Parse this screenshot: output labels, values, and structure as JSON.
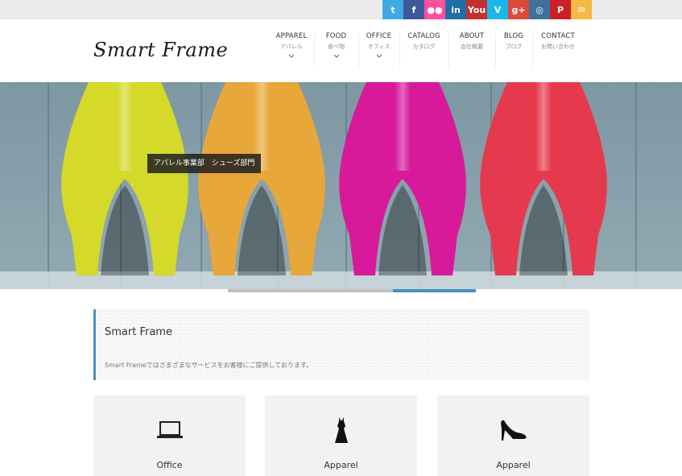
{
  "brand": {
    "logo": "Smart Frame"
  },
  "social": [
    {
      "name": "twitter-icon",
      "glyph": "t",
      "color": "#3fa9e6"
    },
    {
      "name": "facebook-icon",
      "glyph": "f",
      "color": "#3b5998"
    },
    {
      "name": "flickr-icon",
      "glyph": "●●",
      "color": "#ff4fa0"
    },
    {
      "name": "linkedin-icon",
      "glyph": "in",
      "color": "#1d6fa5"
    },
    {
      "name": "youtube-icon",
      "glyph": "You",
      "color": "#c4302b"
    },
    {
      "name": "vimeo-icon",
      "glyph": "V",
      "color": "#1ab7ea"
    },
    {
      "name": "google-plus-icon",
      "glyph": "g+",
      "color": "#dc4a38"
    },
    {
      "name": "instagram-icon",
      "glyph": "◎",
      "color": "#3f729b"
    },
    {
      "name": "pinterest-icon",
      "glyph": "P",
      "color": "#cb2027"
    },
    {
      "name": "mail-icon",
      "glyph": "✉",
      "color": "#f4b942"
    }
  ],
  "nav": [
    {
      "en": "APPAREL",
      "jp": "アパレル",
      "dropdown": true
    },
    {
      "en": "FOOD",
      "jp": "食べ物",
      "dropdown": true
    },
    {
      "en": "OFFICE",
      "jp": "オフィス",
      "dropdown": true
    },
    {
      "en": "CATALOG",
      "jp": "カタログ",
      "dropdown": false
    },
    {
      "en": "ABOUT",
      "jp": "会社概要",
      "dropdown": false
    },
    {
      "en": "BLOG",
      "jp": "ブログ",
      "dropdown": false
    },
    {
      "en": "CONTACT",
      "jp": "お問い合わせ",
      "dropdown": false
    }
  ],
  "hero": {
    "caption": "アパレル事業部　シューズ部門",
    "shoe_colors": [
      "#d4d92a",
      "#e8a73a",
      "#d7199a",
      "#e53a4e"
    ],
    "slides": [
      {
        "color": "#bfbfbf",
        "active": false
      },
      {
        "color": "#bfbfbf",
        "active": false
      },
      {
        "color": "#4a8fc0",
        "active": true
      }
    ]
  },
  "intro": {
    "title": "Smart Frame",
    "text": "Smart Frameではさまざまなサービスをお客様にご提供しております。"
  },
  "cards": [
    {
      "icon": "laptop-icon",
      "label": "Office"
    },
    {
      "icon": "dress-icon",
      "label": "Apparel"
    },
    {
      "icon": "high-heel-icon",
      "label": "Apparel"
    }
  ]
}
